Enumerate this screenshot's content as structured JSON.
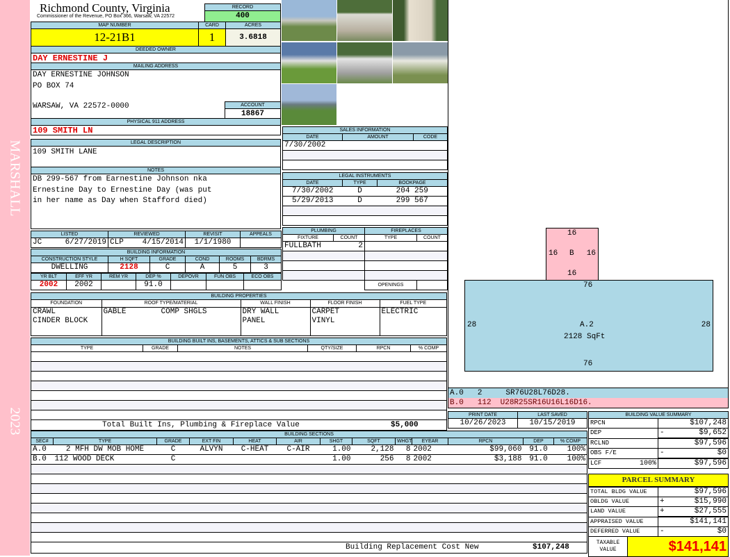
{
  "side": {
    "top": "MARSHALL",
    "bottom": "2023"
  },
  "header": {
    "title": "Richmond County, Virginia",
    "subtitle": "Commissioner of the Revenue, PO Box 366, Warsaw, VA 22572",
    "record_label": "RECORD",
    "record": "400"
  },
  "parcel": {
    "map_label": "MAP NUMBER",
    "map": "12-21B1",
    "card_label": "CARD",
    "card": "1",
    "acres_label": "ACRES",
    "acres": "3.6818"
  },
  "owner": {
    "label": "DEEDED OWNER",
    "name": "DAY ERNESTINE J"
  },
  "mailing": {
    "label": "MAILING ADDRESS",
    "line1": "DAY ERNESTINE JOHNSON",
    "line2": "PO BOX 74",
    "line3": "WARSAW, VA 22572-0000",
    "account_label": "ACCOUNT",
    "account": "18867"
  },
  "physical": {
    "label": "PHYSICAL 911 ADDRESS",
    "value": "109 SMITH LN"
  },
  "legal": {
    "label": "LEGAL DESCRIPTION",
    "value": "109 SMITH LANE"
  },
  "notes": {
    "label": "NOTES",
    "lines": [
      "DB 299-567 from Earnestine Johnson nka",
      "Ernestine Day to Ernestine Day (was put",
      "in her name as Day when Stafford died)"
    ]
  },
  "listing": {
    "headers": [
      "LISTED",
      "REVIEWED",
      "REVISIT",
      "APPEALS"
    ],
    "listed_by": "JC",
    "listed": "6/27/2019",
    "reviewed_by": "CLP",
    "reviewed": "4/15/2014",
    "revisit": "1/1/1980",
    "appeals": ""
  },
  "building_info": {
    "label": "BUILDING INFORMATION",
    "headers1": [
      "CONSTRUCTION STYLE",
      "H SQFT",
      "GRADE",
      "COND",
      "ROOMS",
      "BDRMS"
    ],
    "values1": [
      "DWELLING",
      "2128",
      "C",
      "A",
      "5",
      "3"
    ],
    "headers2": [
      "YR BLT",
      "EFF YR",
      "REM YR",
      "DEP %",
      "DEPOVR",
      "FUN OBS",
      "ECO OBS"
    ],
    "values2": [
      "2002",
      "2002",
      "",
      "91.0",
      "",
      "",
      ""
    ]
  },
  "sales": {
    "label": "SALES INFORMATION",
    "headers": [
      "DATE",
      "AMOUNT",
      "CODE"
    ],
    "rows": [
      [
        "7/30/2002",
        "",
        ""
      ]
    ]
  },
  "instruments": {
    "label": "LEGAL INSTRUMENTS",
    "headers": [
      "DATE",
      "TYPE",
      "BOOKPAGE"
    ],
    "rows": [
      [
        "7/30/2002",
        "D",
        "204 259"
      ],
      [
        "5/29/2013",
        "D",
        "299 567"
      ]
    ]
  },
  "plumbing": {
    "label": "PLUMBING",
    "headers": [
      "FIXTURE",
      "COUNT"
    ],
    "rows": [
      [
        "FULLBATH",
        "2"
      ]
    ]
  },
  "fireplaces": {
    "label": "FIREPLACES",
    "headers": [
      "TYPE",
      "COUNT"
    ],
    "openings_label": "OPENINGS"
  },
  "properties": {
    "label": "BUILDING PROPERTIES",
    "headers": [
      "FOUNDATION",
      "ROOF TYPE/MATERIAL",
      "WALL FINISH",
      "FLOOR FINISH",
      "FUEL TYPE"
    ],
    "foundation": [
      "CRAWL",
      "CINDER BLOCK"
    ],
    "roof_type": "GABLE",
    "roof_material": "COMP SHGLS",
    "wall": [
      "DRY WALL",
      "PANEL"
    ],
    "floor": [
      "CARPET",
      "VINYL"
    ],
    "fuel": [
      "ELECTRIC"
    ]
  },
  "builtins": {
    "label": "BUILDING BUILT INS, BASEMENTS, ATTICS & SUB SECTIONS",
    "headers": [
      "TYPE",
      "GRADE",
      "NOTES",
      "QTY/SIZE",
      "RPCN",
      "% COMP"
    ],
    "total_label": "Total Built Ins, Plumbing & Fireplace Value",
    "total": "$5,000"
  },
  "dates": {
    "print_label": "PRINT DATE",
    "print": "10/26/2023",
    "saved_label": "LAST SAVED",
    "saved": "10/15/2019"
  },
  "sections": {
    "label": "BUILDING SECTIONS",
    "headers": [
      "SEC#",
      "TYPE",
      "GRADE",
      "EXT FIN",
      "HEAT",
      "AIR",
      "SHGT",
      "SQFT",
      "WHGT",
      "EYEAR",
      "RPCN",
      "DEP",
      "% COMP"
    ],
    "rows": [
      [
        "A.0",
        "2 MFH DW MOB HOME",
        "C",
        "ALVYN",
        "C-HEAT",
        "C-AIR",
        "1.00",
        "2,128",
        "8",
        "2002",
        "$99,060",
        "91.0",
        "100%"
      ],
      [
        "B.0",
        "112 WOOD DECK",
        "C",
        "",
        "",
        "",
        "1.00",
        "256",
        "8",
        "2002",
        "$3,188",
        "91.0",
        "100%"
      ]
    ],
    "footer_label": "Building Replacement Cost New",
    "footer_value": "$107,248"
  },
  "sketch": {
    "b_top": "16",
    "b_left": "16",
    "b_right": "16",
    "b_bottom": "16",
    "b_label": "B",
    "a_top": "76",
    "a_left": "28",
    "a_right": "28",
    "a_bottom": "76",
    "a_label": "A.2",
    "a_area": "2128 SqFt",
    "legend": [
      {
        "sec": "A.0",
        "code": "2",
        "path": "SR76U28L76D28."
      },
      {
        "sec": "B.0",
        "code": "112",
        "path": "U28R25SR16U16L16D16."
      }
    ],
    "colors": {
      "a": "#add8e6",
      "b": "#ffc0cb"
    }
  },
  "value_summary": {
    "label": "BUILDING VALUE SUMMARY",
    "rows": [
      {
        "label": "RPCN",
        "sign": "",
        "value": "$107,248"
      },
      {
        "label": "DEP",
        "sign": "-",
        "value": "$9,652"
      },
      {
        "label": "RCLND",
        "sign": "",
        "value": "$97,596"
      },
      {
        "label": "OBS F/E",
        "sign": "-",
        "value": "$0"
      },
      {
        "label": "LCF",
        "pct": "100%",
        "sign": "",
        "value": "$97,596"
      }
    ]
  },
  "parcel_summary": {
    "label": "PARCEL SUMMARY",
    "rows": [
      {
        "label": "TOTAL BLDG VALUE",
        "sign": "",
        "value": "$97,596"
      },
      {
        "label": "OBLDG VALUE",
        "sign": "+",
        "value": "$15,990"
      },
      {
        "label": "LAND VALUE",
        "sign": "+",
        "value": "$27,555"
      },
      {
        "label": "APPRAISED VALUE",
        "sign": "",
        "value": "$141,141"
      },
      {
        "label": "DEFERRED VALUE",
        "sign": "-",
        "value": "$0"
      }
    ],
    "taxable_label": "TAXABLE VALUE",
    "taxable": "$141,141"
  }
}
